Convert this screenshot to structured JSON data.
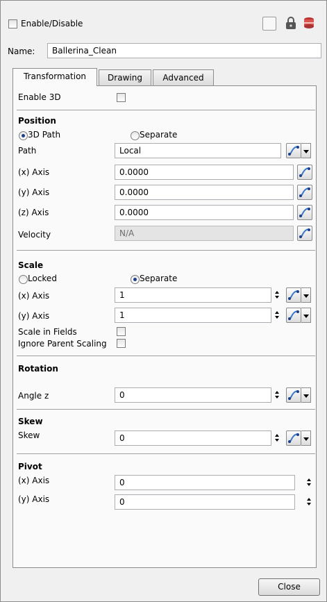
{
  "header": {
    "enable_label": "Enable/Disable"
  },
  "name": {
    "label": "Name:",
    "value": "Ballerina_Clean"
  },
  "tabs": [
    {
      "label": "Transformation"
    },
    {
      "label": "Drawing"
    },
    {
      "label": "Advanced"
    }
  ],
  "enable3d": {
    "label": "Enable 3D"
  },
  "position": {
    "title": "Position",
    "radio_3dpath": "3D Path",
    "radio_separate": "Separate",
    "path_label": "Path",
    "path_value": "Local",
    "x_label": "(x) Axis",
    "x_value": "0.0000",
    "y_label": "(y) Axis",
    "y_value": "0.0000",
    "z_label": "(z) Axis",
    "z_value": "0.0000",
    "velocity_label": "Velocity",
    "velocity_value": "N/A"
  },
  "scale": {
    "title": "Scale",
    "radio_locked": "Locked",
    "radio_separate": "Separate",
    "x_label": "(x) Axis",
    "x_value": "1",
    "y_label": "(y) Axis",
    "y_value": "1",
    "fields_label": "Scale in Fields",
    "ignore_label": "Ignore Parent Scaling"
  },
  "rotation": {
    "title": "Rotation",
    "angle_label": "Angle z",
    "angle_value": "0"
  },
  "skew": {
    "title": "Skew",
    "skew_label": "Skew",
    "skew_value": "0"
  },
  "pivot": {
    "title": "Pivot",
    "x_label": "(x) Axis",
    "x_value": "0",
    "y_label": "(y) Axis",
    "y_value": "0"
  },
  "footer": {
    "close_label": "Close"
  },
  "icons": {
    "lock": "lock-icon",
    "layer_color": "layer-color-icon",
    "function": "function-curve-icon"
  },
  "colors": {
    "radio_dot": "#1d3f8c",
    "function_icon": "#3a78c8",
    "layer_color": "#d9534f"
  }
}
